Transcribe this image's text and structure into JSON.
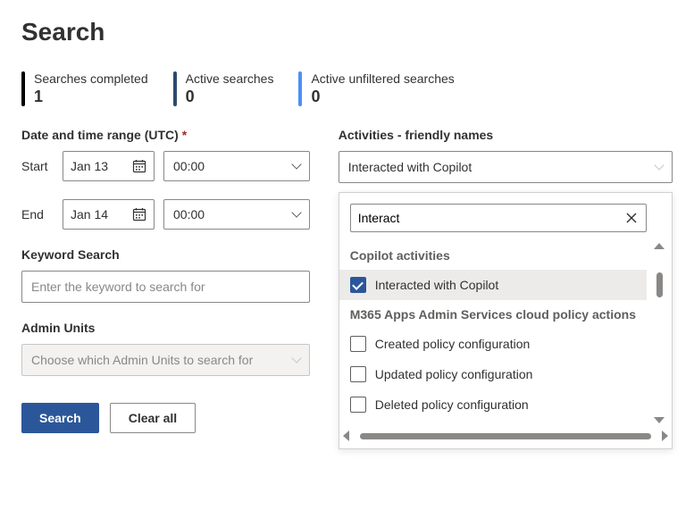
{
  "page_title": "Search",
  "stats": {
    "completed_label": "Searches completed",
    "completed_value": "1",
    "active_label": "Active searches",
    "active_value": "0",
    "unfiltered_label": "Active unfiltered searches",
    "unfiltered_value": "0"
  },
  "date_range": {
    "label": "Date and time range (UTC)",
    "required_mark": "*",
    "start_label": "Start",
    "start_date": "Jan 13",
    "start_time": "00:00",
    "end_label": "End",
    "end_date": "Jan 14",
    "end_time": "00:00"
  },
  "keyword": {
    "label": "Keyword Search",
    "placeholder": "Enter the keyword to search for"
  },
  "admin_units": {
    "label": "Admin Units",
    "placeholder": "Choose which Admin Units to search for"
  },
  "buttons": {
    "search": "Search",
    "clear": "Clear all"
  },
  "activities": {
    "label": "Activities - friendly names",
    "selected": "Interacted with Copilot",
    "search_value": "Interact",
    "groups": [
      {
        "name": "Copilot activities",
        "options": [
          {
            "label": "Interacted with Copilot",
            "checked": true
          }
        ]
      },
      {
        "name": "M365 Apps Admin Services cloud policy actions",
        "options": [
          {
            "label": "Created policy configuration",
            "checked": false
          },
          {
            "label": "Updated policy configuration",
            "checked": false
          },
          {
            "label": "Deleted policy configuration",
            "checked": false
          }
        ]
      }
    ]
  }
}
